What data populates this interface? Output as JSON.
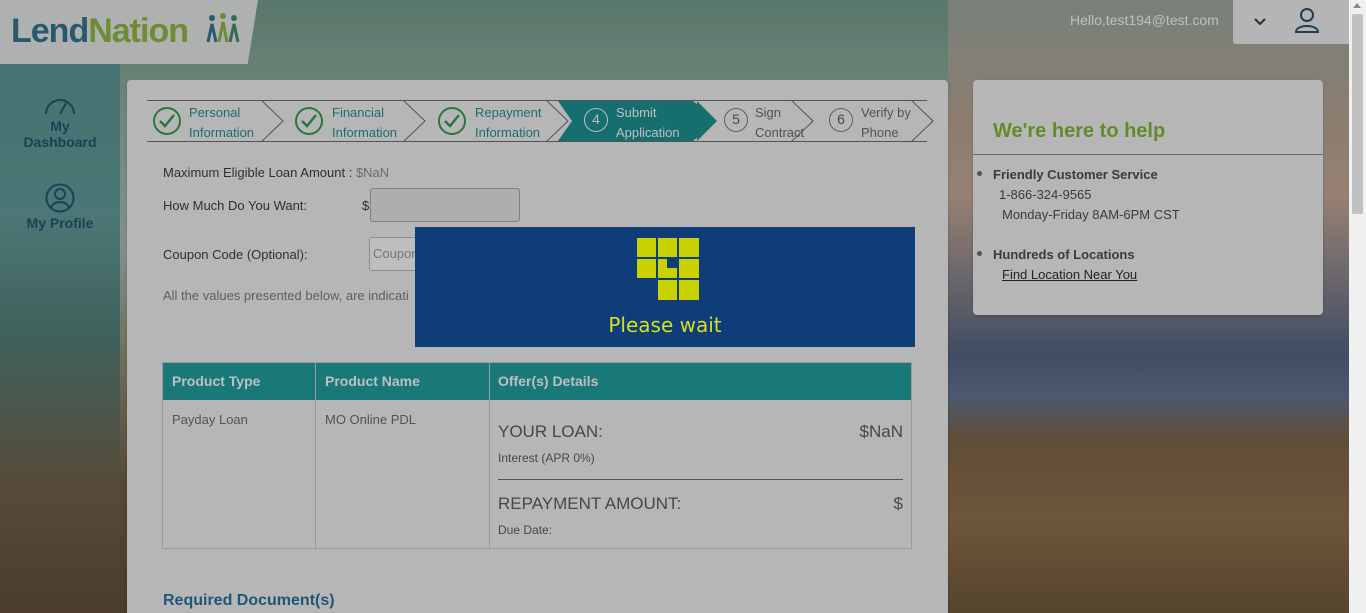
{
  "header": {
    "logo_lend": "Lend",
    "logo_nation": "Nation",
    "greeting": "Hello,test194@test.com"
  },
  "sidebar": {
    "items": [
      {
        "label_line1": "My",
        "label_line2": "Dashboard",
        "icon": "gauge-icon"
      },
      {
        "label": "My Profile",
        "icon": "person-icon"
      }
    ]
  },
  "steps": [
    {
      "line1": "Personal",
      "line2": "Information",
      "status": "complete"
    },
    {
      "line1": "Financial",
      "line2": "Information",
      "status": "complete"
    },
    {
      "line1": "Repayment",
      "line2": "Information",
      "status": "complete"
    },
    {
      "number": "4",
      "line1": "Submit",
      "line2": "Application",
      "status": "active"
    },
    {
      "number": "5",
      "line1": "Sign",
      "line2": "Contract",
      "status": "pending"
    },
    {
      "number": "6",
      "line1": "Verify by",
      "line2": "Phone",
      "status": "pending"
    }
  ],
  "form": {
    "max_amount_label": "Maximum Eligible Loan Amount :",
    "max_amount_value": "$NaN",
    "how_much_label": "How Much Do You Want:",
    "currency": "$",
    "amount_value": "",
    "coupon_label": "Coupon Code (Optional):",
    "coupon_placeholder": "Coupon",
    "note": "All the values presented below, are indicati"
  },
  "table": {
    "headers": [
      "Product Type",
      "Product Name",
      "Offer(s) Details"
    ],
    "row": {
      "product_type": "Payday Loan",
      "product_name": "MO Online PDL",
      "your_loan_label": "YOUR LOAN:",
      "your_loan_value": "$NaN",
      "interest": "Interest (APR 0%)",
      "repayment_label": "REPAYMENT AMOUNT:",
      "repayment_value": "$",
      "due_date": "Due Date:"
    }
  },
  "required_docs": "Required Document(s)",
  "help": {
    "title": "We're here to help",
    "service_heading": "Friendly Customer Service",
    "phone": "1-866-324-9565",
    "hours": "Monday-Friday 8AM-6PM CST",
    "locations_heading": "Hundreds of Locations",
    "find_link": "Find Location Near You"
  },
  "wait": {
    "text": "Please wait"
  },
  "colors": {
    "teal": "#108d8d",
    "brand_blue": "#2a6f8a",
    "brand_green": "#8db83a",
    "wait_bg": "#0f3d7a",
    "wait_fg": "#d4e020"
  }
}
